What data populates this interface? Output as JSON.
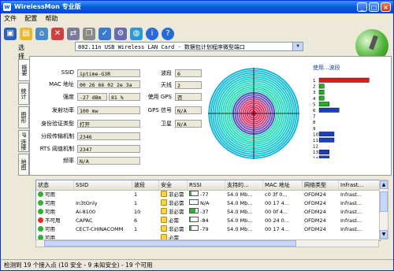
{
  "window": {
    "title": "WirelessMon 专业版"
  },
  "menu": [
    {
      "label": "文件"
    },
    {
      "label": "配置"
    },
    {
      "label": "帮助"
    }
  ],
  "toolbar": {
    "icons": [
      "save-icon",
      "open-icon",
      "network-icon",
      "delete-icon",
      "connect-icon",
      "copy-icon",
      "check-icon",
      "settings-icon",
      "globe-icon",
      "info-icon",
      "help-icon"
    ]
  },
  "nic": {
    "label": "选择网卡",
    "value": "802.11n USB Wireless LAN Card - 数据包计划程序微型端口"
  },
  "tabs": [
    {
      "label": "概要"
    },
    {
      "label": "统计"
    },
    {
      "label": "图形"
    },
    {
      "label": "IP 连接"
    },
    {
      "label": "地图"
    }
  ],
  "details": {
    "ssid": {
      "label": "SSID",
      "value": "iptime-G3R"
    },
    "mac": {
      "label": "MAC 地址",
      "value": "00 26 66 02 2e 3a"
    },
    "strength": {
      "label": "强度",
      "value": "-27 dBm",
      "percent": "81 %"
    },
    "tx_power": {
      "label": "发射功率",
      "value": "100 mw"
    },
    "auth": {
      "label": "身份验证类型",
      "value": "打开"
    },
    "frag": {
      "label": "分段传输机制",
      "value": "2346"
    },
    "rts": {
      "label": "RTS 阈值机制",
      "value": "2347"
    },
    "freq": {
      "label": "频率",
      "value": "N/A"
    },
    "channel": {
      "label": "波段",
      "value": "6"
    },
    "antenna": {
      "label": "天线",
      "value": "2"
    },
    "gps": {
      "label": "使用 GPS",
      "value": "否"
    },
    "gps_signal": {
      "label": "GPS 信号",
      "value": "N/A"
    },
    "satellite": {
      "label": "卫星",
      "value": "N/A"
    }
  },
  "chart_data": {
    "type": "bar",
    "title": "使用...波段",
    "categories": [
      "1",
      "2",
      "3",
      "4",
      "5",
      "6",
      "7",
      "8",
      "9",
      "10",
      "11",
      "12",
      "13",
      "14"
    ],
    "values": [
      10,
      1,
      1,
      1,
      2,
      4,
      0,
      0,
      0,
      3,
      3,
      0,
      2,
      2
    ],
    "bar_colors": [
      "#e01818",
      "#20b020",
      "#20b020",
      "#20b020",
      "#20b020",
      "#1a3fc0",
      "#1a3fc0",
      "#1a3fc0",
      "#1a3fc0",
      "#1a3fc0",
      "#1a3fc0",
      "#1a3fc0",
      "#1a3fc0",
      "#1a3fc0"
    ],
    "xlim": [
      0,
      10
    ]
  },
  "table": {
    "columns": [
      "状态",
      "SSID",
      "波段",
      "安全",
      "RSSI",
      "支持的...",
      "MAC 地址",
      "网络类型",
      "Infrast..."
    ],
    "rows": [
      {
        "status": "可用",
        "status_color": "#2db32d",
        "ssid": "",
        "channel": "1",
        "security": "非必需",
        "rssi": "-77",
        "signal": 0.2,
        "rate": "54.0 Mb...",
        "mac": "c0 3f 0...",
        "type": "OFDM24",
        "infra": "Infrast..."
      },
      {
        "status": "可用",
        "status_color": "#2db32d",
        "ssid": "In3tOnly",
        "channel": "1",
        "security": "非必需",
        "rssi": "N/A",
        "signal": 0,
        "rate": "54.0 Mb...",
        "mac": "00 17 4...",
        "type": "OFDM24",
        "infra": "Infrast..."
      },
      {
        "status": "可用",
        "status_color": "#2db32d",
        "ssid": "Ai-8100",
        "channel": "10",
        "security": "非必需",
        "rssi": "-37",
        "signal": 0.7,
        "rate": "54.0 Mb...",
        "mac": "00 0f 4...",
        "type": "OFDM24",
        "infra": "Infrast..."
      },
      {
        "status": "不可用",
        "status_color": "#e03020",
        "ssid": "CAPAC",
        "channel": "6",
        "security": "必需",
        "rssi": "-84",
        "signal": 0.1,
        "rate": "54.0 Mb...",
        "mac": "00 24 0...",
        "type": "OFDM24",
        "infra": "Infrast..."
      },
      {
        "status": "可用",
        "status_color": "#2db32d",
        "ssid": "CECT-CHINACOMM",
        "channel": "1",
        "security": "非必需",
        "rssi": "-79",
        "signal": 0.2,
        "rate": "54.0 Mb...",
        "mac": "00 17 4...",
        "type": "OFDM24",
        "infra": "Infrast..."
      },
      {
        "status": "可用",
        "status_color": "#2db32d",
        "ssid": "",
        "channel": "",
        "security": "必需",
        "rssi": "",
        "signal": 0,
        "rate": "",
        "mac": "",
        "type": "",
        "infra": ""
      }
    ]
  },
  "status_bar": {
    "text": "检测到 19 个接入点 (10 安全 - 9 未知安全) - 19 个可用"
  }
}
